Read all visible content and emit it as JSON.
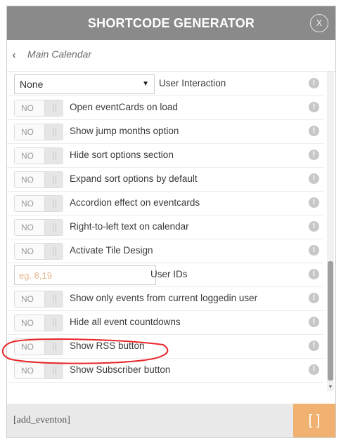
{
  "header": {
    "title": "SHORTCODE GENERATOR",
    "close_label": "X"
  },
  "breadcrumb": {
    "back_icon": "‹",
    "crumb": "Main Calendar"
  },
  "rows": [
    {
      "type": "select",
      "value": "None",
      "label": "User Interaction"
    },
    {
      "type": "toggle",
      "state": "NO",
      "label": "Open eventCards on load"
    },
    {
      "type": "toggle",
      "state": "NO",
      "label": "Show jump months option"
    },
    {
      "type": "toggle",
      "state": "NO",
      "label": "Hide sort options section"
    },
    {
      "type": "toggle",
      "state": "NO",
      "label": "Expand sort options by default"
    },
    {
      "type": "toggle",
      "state": "NO",
      "label": "Accordion effect on eventcards"
    },
    {
      "type": "toggle",
      "state": "NO",
      "label": "Right-to-left text on calendar"
    },
    {
      "type": "toggle",
      "state": "NO",
      "label": "Activate Tile Design"
    },
    {
      "type": "input",
      "placeholder": "eg. 8,19",
      "label": "User IDs"
    },
    {
      "type": "toggle",
      "state": "NO",
      "label": "Show only events from current loggedin user"
    },
    {
      "type": "toggle",
      "state": "NO",
      "label": "Hide all event countdowns"
    },
    {
      "type": "toggle",
      "state": "NO",
      "label": "Show RSS button"
    },
    {
      "type": "toggle",
      "state": "NO",
      "label": "Show Subscriber button"
    }
  ],
  "info_icon": "!",
  "footer": {
    "code": "[add_eventon]",
    "copy_label": "[ ]"
  },
  "colors": {
    "header_bg": "#8a8a8a",
    "accent": "#f1b171",
    "annotation": "#e8262b"
  }
}
